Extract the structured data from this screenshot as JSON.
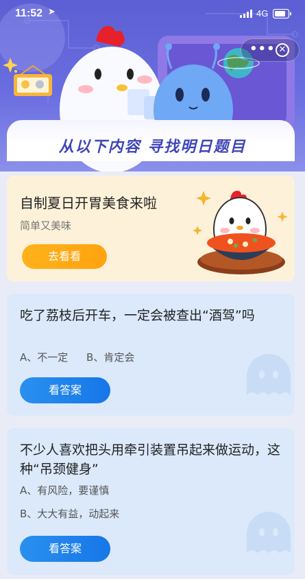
{
  "status_bar": {
    "time": "11:52",
    "location_glyph": "➤",
    "network": "4G"
  },
  "capsule": {
    "more_glyph": "•••",
    "close_glyph": "✕"
  },
  "banner": {
    "title": "从以下内容 寻找明日题目"
  },
  "feature_card": {
    "title": "自制夏日开胃美食来啦",
    "subtitle": "简单又美味",
    "button_label": "去看看"
  },
  "questions": [
    {
      "title": "吃了荔枝后开车，一定会被查出“酒驾”吗",
      "options": [
        "A、不一定",
        "B、肯定会"
      ],
      "button_label": "看答案"
    },
    {
      "title": "不少人喜欢把头用牵引装置吊起来做运动，这种“吊颈健身”",
      "options": [
        "A、有风险，要谨慎",
        "B、大大有益，动起来"
      ],
      "button_label": "看答案"
    }
  ],
  "colors": {
    "header": "#5b5fd3",
    "feature_bg": "#fdf2d9",
    "question_bg": "#dbe9fb",
    "orange_button": "#ffa30f",
    "blue_button": "#1676e8",
    "title_accent": "#3e45b8"
  }
}
